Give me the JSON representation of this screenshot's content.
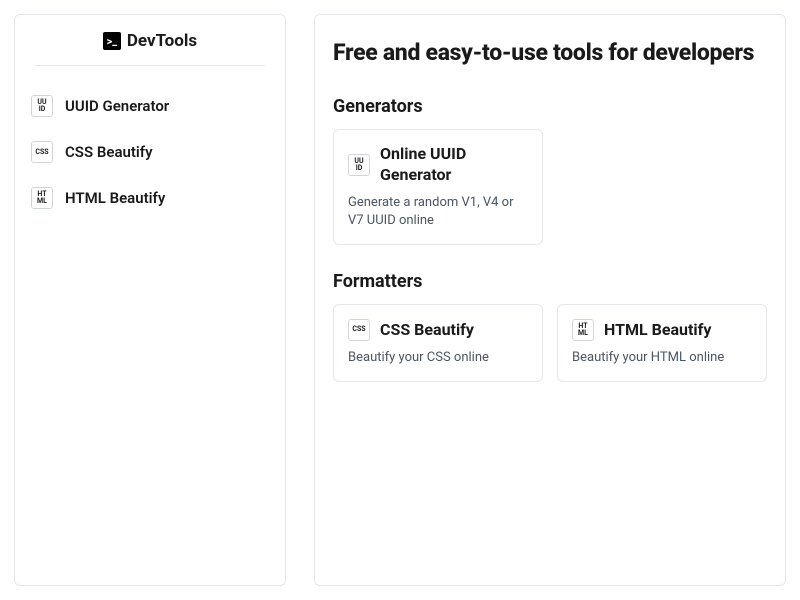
{
  "brand": {
    "name": "DevTools",
    "glyph": ">_"
  },
  "sidebar": {
    "items": [
      {
        "label": "UUID Generator",
        "icon_lines": [
          "UU",
          "ID"
        ]
      },
      {
        "label": "CSS Beautify",
        "icon_lines": [
          "CSS"
        ]
      },
      {
        "label": "HTML Beautify",
        "icon_lines": [
          "HT",
          "ML"
        ]
      }
    ]
  },
  "page": {
    "title": "Free and easy-to-use tools for developers"
  },
  "sections": [
    {
      "title": "Generators",
      "cards": [
        {
          "title": "Online UUID Generator",
          "desc": "Generate a random V1, V4 or V7 UUID online",
          "icon_lines": [
            "UU",
            "ID"
          ]
        }
      ]
    },
    {
      "title": "Formatters",
      "cards": [
        {
          "title": "CSS Beautify",
          "desc": "Beautify your CSS online",
          "icon_lines": [
            "CSS"
          ]
        },
        {
          "title": "HTML Beautify",
          "desc": "Beautify your HTML online",
          "icon_lines": [
            "HT",
            "ML"
          ]
        }
      ]
    }
  ]
}
